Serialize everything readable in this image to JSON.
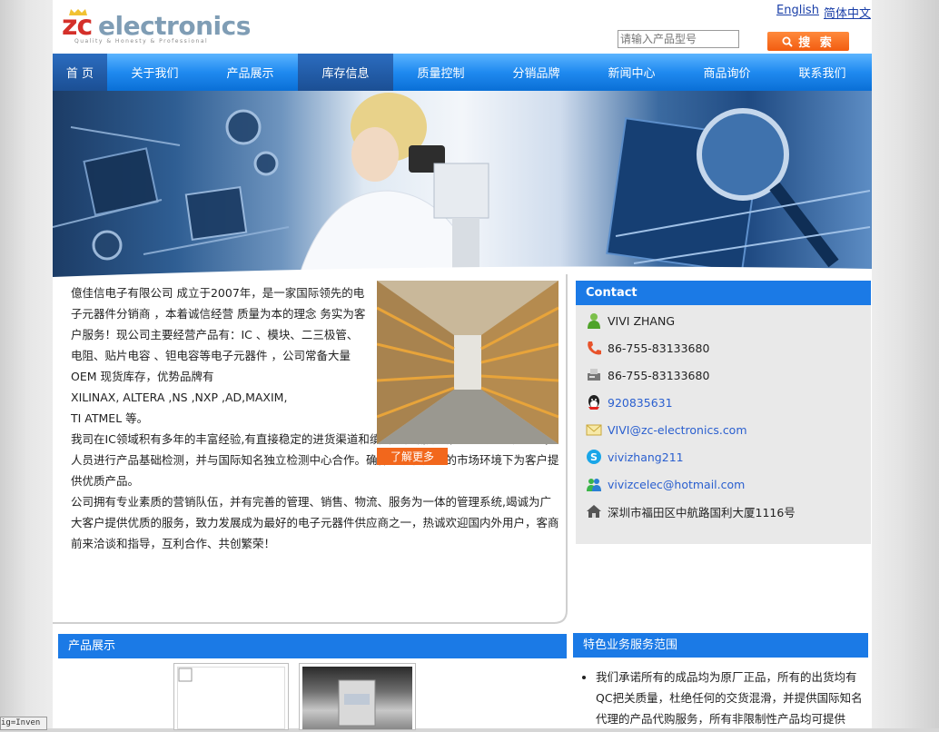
{
  "header": {
    "logo_letters": "zc",
    "logo_word": "electronics",
    "logo_tagline": "Quality & Honesty & Professional",
    "lang_english": "English",
    "lang_chinese": "简体中文",
    "search_placeholder": "请输入产品型号",
    "search_button": "搜 索"
  },
  "nav": {
    "items": [
      {
        "label": "首  页"
      },
      {
        "label": "关于我们"
      },
      {
        "label": "产品展示"
      },
      {
        "label": "库存信息"
      },
      {
        "label": "质量控制"
      },
      {
        "label": "分销品牌"
      },
      {
        "label": "新闻中心"
      },
      {
        "label": "商品询价"
      },
      {
        "label": "联系我们"
      }
    ]
  },
  "intro": {
    "p1": "億佳信电子有限公司  成立于2007年，是一家国际领先的电子元器件分销商 ，本着诚信经营 质量为本的理念 务实为客户服务！现公司主要经营产品有：IC 、模块、二三极管、电阻、贴片电容 、钽电容等电子元器件 ，公司常备大量OEM 现货库存，优势品牌有",
    "p2": "XILINAX, ALTERA ,NS ,NXP ,AD,MAXIM,",
    "p3": "TI  ATMEL 等。",
    "p4": "我司在IC领域积有多年的丰富经验,有直接稳定的进货渠道和缜密的检测方法，公司拥有专业的QC人员进行产品基础检测，并与国际知名独立检测中心合作。确保可以在复杂的市场环境下为客户提供优质产品。",
    "p5": "公司拥有专业素质的营销队伍，并有完善的管理、销售、物流、服务为一体的管理系统,竭诚为广大客户提供优质的服务，致力发展成为最好的电子元器件供应商之一，热诚欢迎国内外用户，客商前来洽谈和指导，互利合作、共创繁荣！",
    "more_button": "了解更多"
  },
  "contact": {
    "title": "Contact",
    "name": "VIVI ZHANG",
    "phone": "86-755-83133680",
    "fax": "86-755-83133680",
    "qq": "920835631",
    "email": "VIVI@zc-electronics.com",
    "skype": "vivizhang211",
    "msn": "vivizcelec@hotmail.com",
    "address": "深圳市福田区中航路国利大厦1116号"
  },
  "products": {
    "title": "产品展示"
  },
  "services": {
    "title": "特色业务服务范围",
    "item1": "我们承诺所有的成品均为原厂正品，所有的出货均有QC把关质量，杜绝任何的交货混滑，并提供国际知名代理的产品代购服务，所有非限制性产品均可提供"
  },
  "statusbar": {
    "text": "ig=Inven"
  }
}
